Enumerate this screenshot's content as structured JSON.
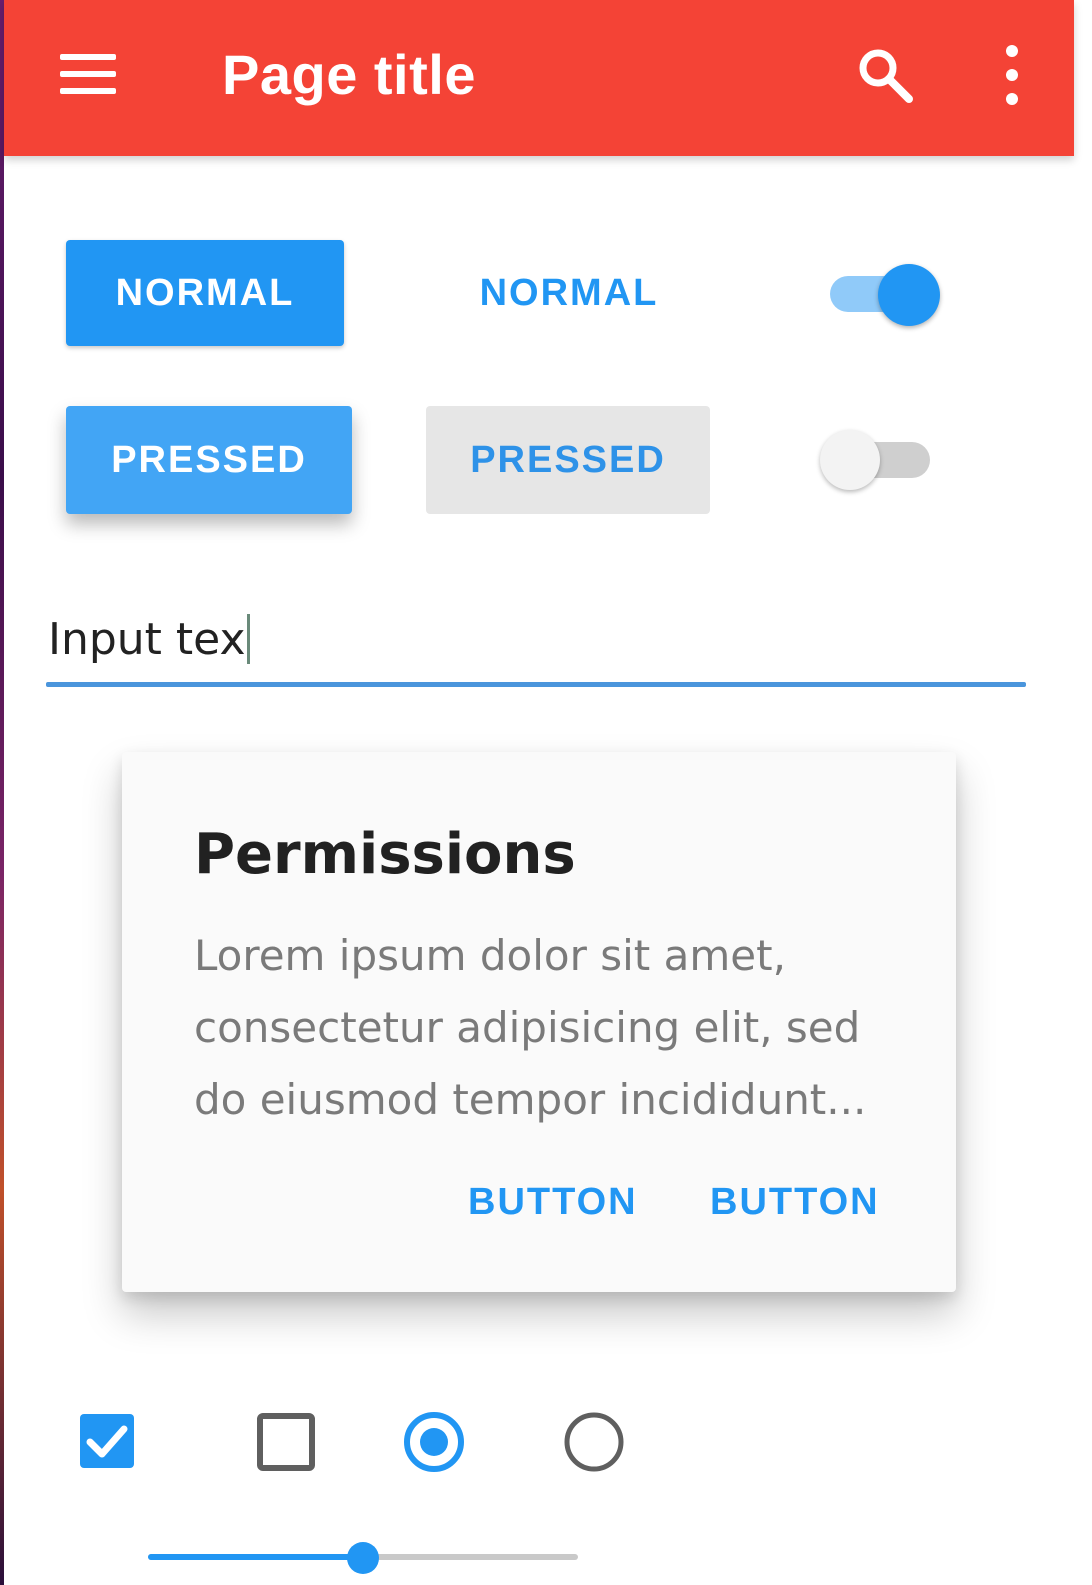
{
  "app_bar": {
    "title": "Page title",
    "background": "#f44336",
    "icons": [
      "menu-icon",
      "search-icon",
      "more-vert-icon"
    ]
  },
  "buttons": {
    "raised_normal": "NORMAL",
    "flat_normal": "NORMAL",
    "raised_pressed": "PRESSED",
    "flat_pressed": "PRESSED",
    "accent": "#2196f3"
  },
  "switches": {
    "first_on": true,
    "second_on": false
  },
  "text_field": {
    "value": "Input tex"
  },
  "dialog": {
    "title": "Permissions",
    "body_lines": [
      "Lorem ipsum dolor sit amet,",
      "consectetur adipisicing elit, sed",
      "do eiusmod tempor incididunt..."
    ],
    "actions": [
      "BUTTON",
      "BUTTON"
    ]
  },
  "selection_controls": {
    "checkbox_1_checked": true,
    "checkbox_2_checked": false,
    "radio_1_selected": true,
    "radio_2_selected": false
  },
  "slider": {
    "value_fraction": 0.5
  }
}
